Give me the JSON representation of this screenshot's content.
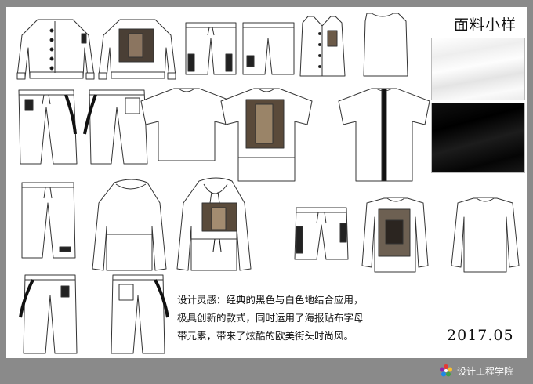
{
  "board": {
    "fabric_title": "面料小样",
    "swatches": [
      "white-fabric-swatch",
      "black-fabric-swatch"
    ],
    "inspiration_lines": [
      "设计灵感：经典的黑色与白色地结合应用，",
      "极具创新的款式，同时运用了海报贴布字母",
      "带元素，带来了炫酷的欧美街头时尚风。"
    ],
    "date": "2017.05"
  },
  "watermark": {
    "text": "设计工程学院",
    "icon": "flower-logo-icon"
  },
  "colors": {
    "background": "#8a8a8a",
    "board": "#ffffff",
    "ink": "#111111"
  }
}
